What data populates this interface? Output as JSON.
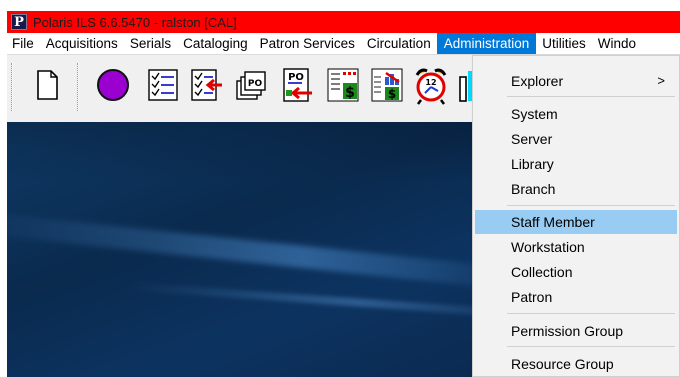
{
  "window": {
    "app_icon_letter": "P",
    "title": "Polaris ILS 6.6.5470 - ralston [CAL]"
  },
  "menubar": {
    "items": [
      {
        "label": "File"
      },
      {
        "label": "Acquisitions"
      },
      {
        "label": "Serials"
      },
      {
        "label": "Cataloging"
      },
      {
        "label": "Patron Services"
      },
      {
        "label": "Circulation"
      },
      {
        "label": "Administration",
        "active": true
      },
      {
        "label": "Utilities"
      },
      {
        "label": "Windo"
      }
    ]
  },
  "toolbar": {
    "buttons": [
      {
        "icon": "new-document-icon"
      },
      {
        "icon": "purple-circle-icon"
      },
      {
        "icon": "checklist-icon"
      },
      {
        "icon": "checklist-arrow-icon"
      },
      {
        "icon": "po-stack-icon"
      },
      {
        "icon": "po-arrow-icon"
      },
      {
        "icon": "invoice-dollar-icon"
      },
      {
        "icon": "fund-chart-dollar-icon"
      },
      {
        "icon": "alarm-clock-icon"
      },
      {
        "icon": "partial-column-icon"
      }
    ],
    "po_label": "PO",
    "clock_label": "12"
  },
  "administration_menu": {
    "items": [
      {
        "label": "Explorer",
        "submenu_arrow": ">"
      },
      {
        "label": "System"
      },
      {
        "label": "Server"
      },
      {
        "label": "Library"
      },
      {
        "label": "Branch"
      },
      {
        "label": "Staff Member",
        "highlighted": true
      },
      {
        "label": "Workstation"
      },
      {
        "label": "Collection"
      },
      {
        "label": "Patron"
      },
      {
        "label": "Permission Group"
      },
      {
        "label": "Resource Group"
      }
    ]
  },
  "colors": {
    "title_bar": "#ff0000",
    "menu_active": "#0078d7",
    "menu_highlight": "#99ccf3",
    "desktop": "#0d2f55"
  }
}
